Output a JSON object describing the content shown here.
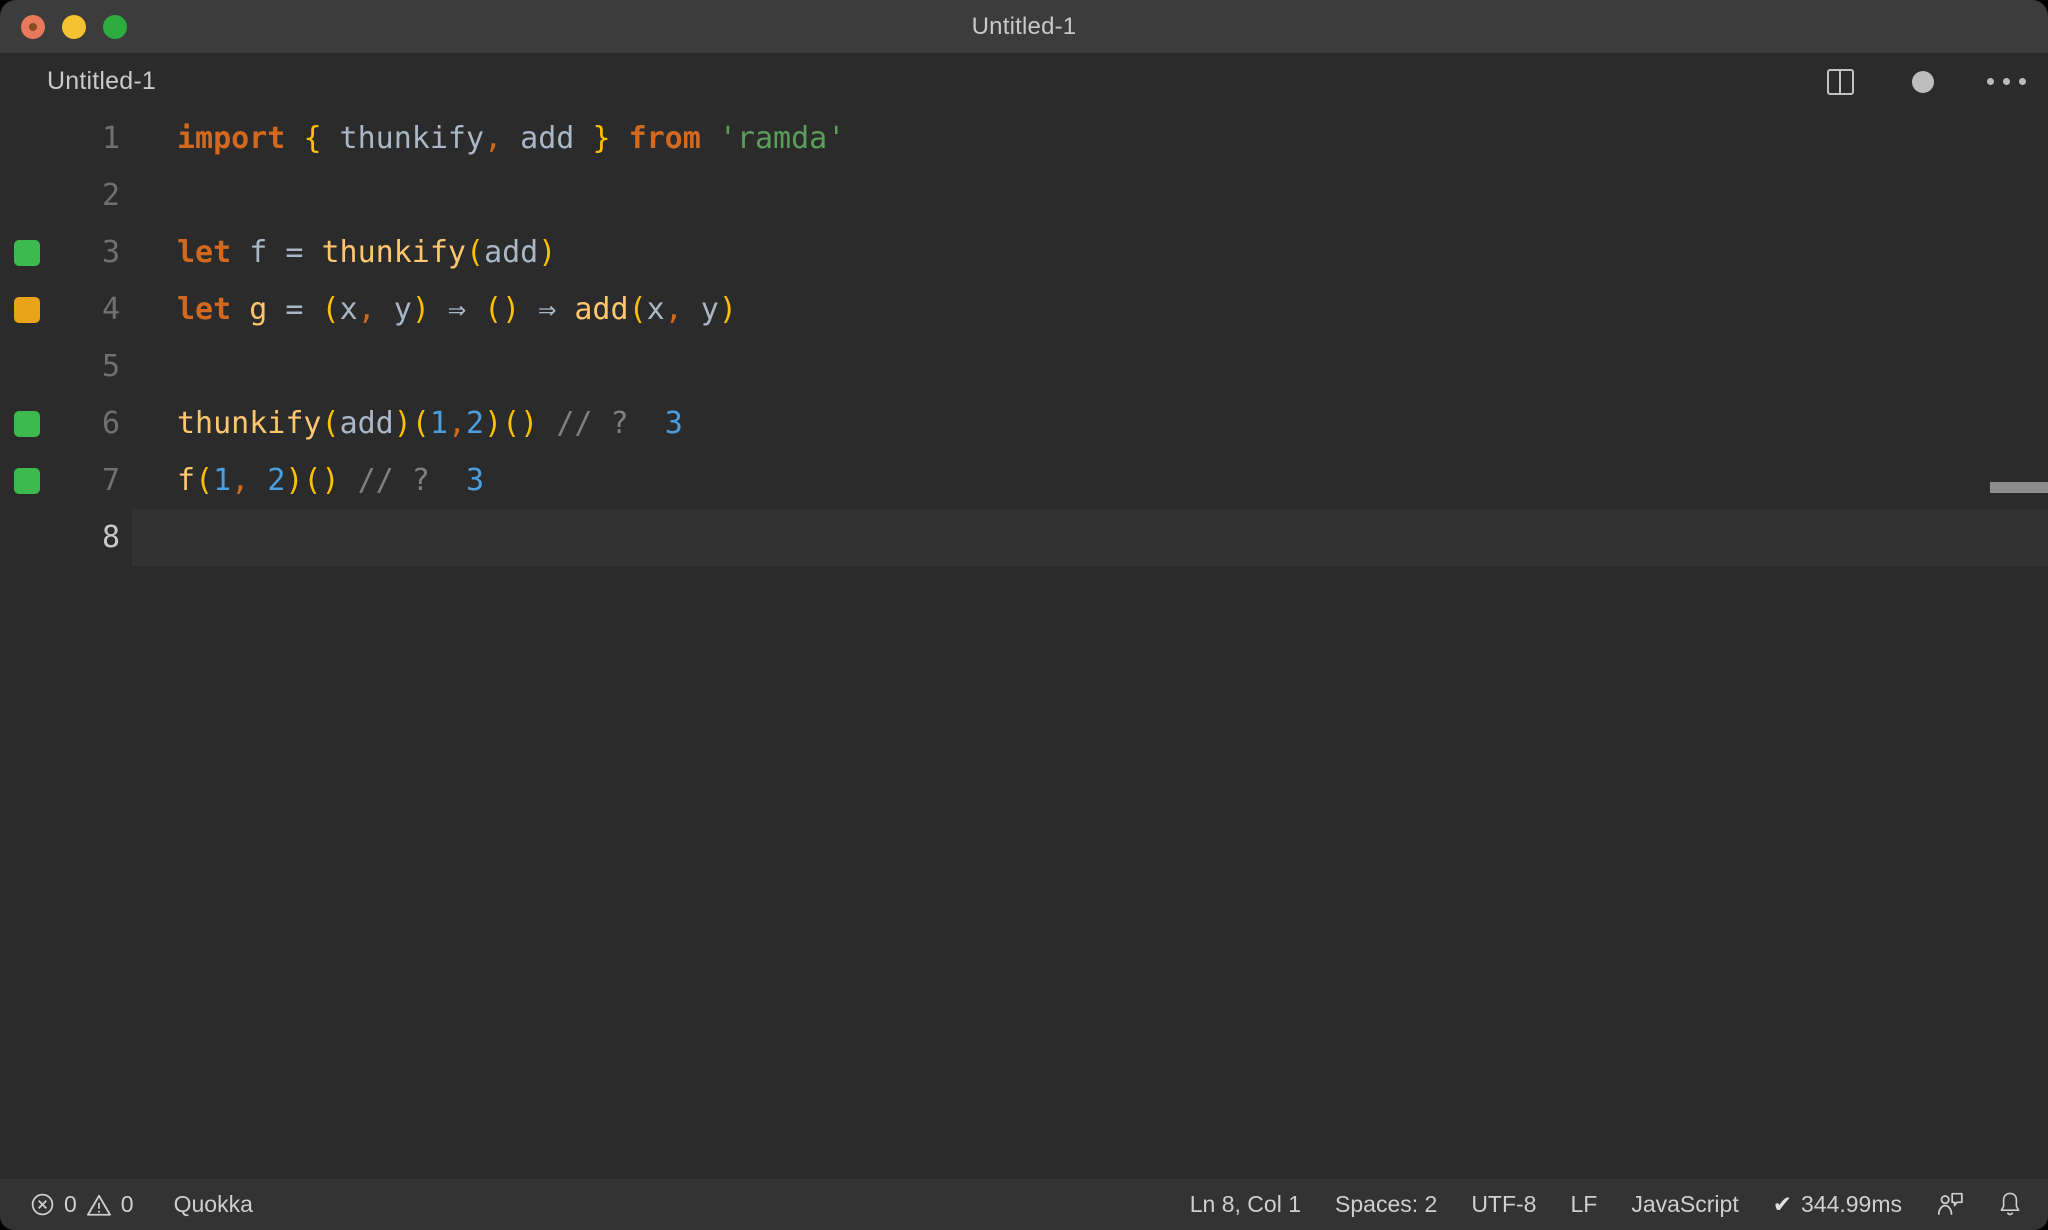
{
  "window": {
    "title": "Untitled-1",
    "traffic_lights": [
      {
        "name": "close",
        "color": "#e8795a"
      },
      {
        "name": "minimize",
        "color": "#f5c330"
      },
      {
        "name": "maximize",
        "color": "#2dad3f"
      }
    ]
  },
  "tabbar": {
    "tab_label": "Untitled-1",
    "actions": [
      {
        "icon": "split-editor-icon"
      },
      {
        "icon": "unsaved-dot-icon"
      },
      {
        "icon": "more-actions-icon"
      }
    ]
  },
  "editor": {
    "language": "JavaScript",
    "lines": [
      {
        "number": "1",
        "marker": null,
        "current": false,
        "tokens": [
          {
            "text": "import",
            "type": "key"
          },
          {
            "text": " ",
            "type": "plain"
          },
          {
            "text": "{",
            "type": "brace"
          },
          {
            "text": " thunkify",
            "type": "ident"
          },
          {
            "text": ",",
            "type": "punct"
          },
          {
            "text": " add ",
            "type": "ident"
          },
          {
            "text": "}",
            "type": "brace"
          },
          {
            "text": " ",
            "type": "plain"
          },
          {
            "text": "from",
            "type": "key"
          },
          {
            "text": " ",
            "type": "plain"
          },
          {
            "text": "'ramda'",
            "type": "str"
          }
        ]
      },
      {
        "number": "2",
        "marker": null,
        "current": false,
        "tokens": []
      },
      {
        "number": "3",
        "marker": "green",
        "current": false,
        "tokens": [
          {
            "text": "let",
            "type": "key"
          },
          {
            "text": " f ",
            "type": "ident"
          },
          {
            "text": "=",
            "type": "ident"
          },
          {
            "text": " ",
            "type": "plain"
          },
          {
            "text": "thunkify",
            "type": "fn"
          },
          {
            "text": "(",
            "type": "brace"
          },
          {
            "text": "add",
            "type": "ident"
          },
          {
            "text": ")",
            "type": "brace"
          }
        ]
      },
      {
        "number": "4",
        "marker": "orange",
        "current": false,
        "tokens": [
          {
            "text": "let",
            "type": "key"
          },
          {
            "text": " ",
            "type": "plain"
          },
          {
            "text": "g",
            "type": "var"
          },
          {
            "text": " ",
            "type": "plain"
          },
          {
            "text": "=",
            "type": "ident"
          },
          {
            "text": " ",
            "type": "plain"
          },
          {
            "text": "(",
            "type": "brace"
          },
          {
            "text": "x",
            "type": "ident"
          },
          {
            "text": ",",
            "type": "punct"
          },
          {
            "text": " y",
            "type": "ident"
          },
          {
            "text": ")",
            "type": "brace"
          },
          {
            "text": " ",
            "type": "plain"
          },
          {
            "text": "⇒",
            "type": "arrow"
          },
          {
            "text": " ",
            "type": "plain"
          },
          {
            "text": "()",
            "type": "brace"
          },
          {
            "text": " ",
            "type": "plain"
          },
          {
            "text": "⇒",
            "type": "arrow"
          },
          {
            "text": " ",
            "type": "plain"
          },
          {
            "text": "add",
            "type": "fn"
          },
          {
            "text": "(",
            "type": "brace"
          },
          {
            "text": "x",
            "type": "ident"
          },
          {
            "text": ",",
            "type": "punct"
          },
          {
            "text": " y",
            "type": "ident"
          },
          {
            "text": ")",
            "type": "brace"
          }
        ]
      },
      {
        "number": "5",
        "marker": null,
        "current": false,
        "tokens": []
      },
      {
        "number": "6",
        "marker": "green",
        "current": false,
        "tokens": [
          {
            "text": "thunkify",
            "type": "fn"
          },
          {
            "text": "(",
            "type": "brace"
          },
          {
            "text": "add",
            "type": "ident"
          },
          {
            "text": ")(",
            "type": "brace"
          },
          {
            "text": "1",
            "type": "num"
          },
          {
            "text": ",",
            "type": "punct"
          },
          {
            "text": "2",
            "type": "num"
          },
          {
            "text": ")()",
            "type": "brace"
          },
          {
            "text": " ",
            "type": "plain"
          },
          {
            "text": "// ?",
            "type": "comment"
          },
          {
            "text": "  ",
            "type": "plain"
          },
          {
            "text": "3",
            "type": "num"
          }
        ]
      },
      {
        "number": "7",
        "marker": "green",
        "current": false,
        "tokens": [
          {
            "text": "f",
            "type": "fn"
          },
          {
            "text": "(",
            "type": "brace"
          },
          {
            "text": "1",
            "type": "num"
          },
          {
            "text": ",",
            "type": "punct"
          },
          {
            "text": " ",
            "type": "plain"
          },
          {
            "text": "2",
            "type": "num"
          },
          {
            "text": ")()",
            "type": "brace"
          },
          {
            "text": " ",
            "type": "plain"
          },
          {
            "text": "// ?",
            "type": "comment"
          },
          {
            "text": "  ",
            "type": "plain"
          },
          {
            "text": "3",
            "type": "num"
          }
        ]
      },
      {
        "number": "8",
        "marker": null,
        "current": true,
        "tokens": []
      }
    ],
    "marker_colors": {
      "green": "#3dba4e",
      "orange": "#e8a317"
    }
  },
  "statusbar": {
    "errors_count": "0",
    "warnings_count": "0",
    "extension": "Quokka",
    "cursor": "Ln 8, Col 1",
    "indentation": "Spaces: 2",
    "encoding": "UTF-8",
    "eol": "LF",
    "language": "JavaScript",
    "runtime_check": "✔",
    "runtime": "344.99ms"
  },
  "colors": {
    "titlebar_bg": "#3c3c3c",
    "editor_bg": "#2b2b2b",
    "statusbar_bg": "#333333",
    "current_line_bg": "#323232",
    "keyword": "#d2691e",
    "function": "#ffc66d",
    "string": "#5a9e5a",
    "number": "#4a9fe0",
    "comment": "#7f7f7f",
    "brace": "#ffc000",
    "identifier": "#a9b7c6"
  }
}
